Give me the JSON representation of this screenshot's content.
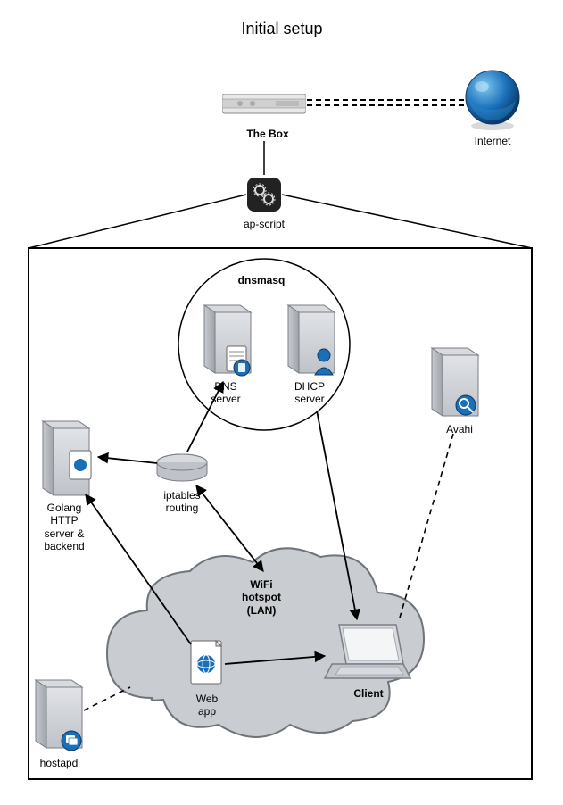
{
  "title": "Initial setup",
  "labels": {
    "the_box": "The Box",
    "internet": "Internet",
    "ap_script": "ap-script",
    "dnsmasq": "dnsmasq",
    "dns_server": "DNS\nserver",
    "dhcp_server": "DHCP\nserver",
    "avahi": "Avahi",
    "golang": "Golang\nHTTP\nserver &\nbackend",
    "iptables": "iptables\nrouting",
    "wifi_hotspot": "WiFi\nhotspot\n(LAN)",
    "web_app": "Web\napp",
    "client": "Client",
    "hostapd": "hostapd"
  }
}
